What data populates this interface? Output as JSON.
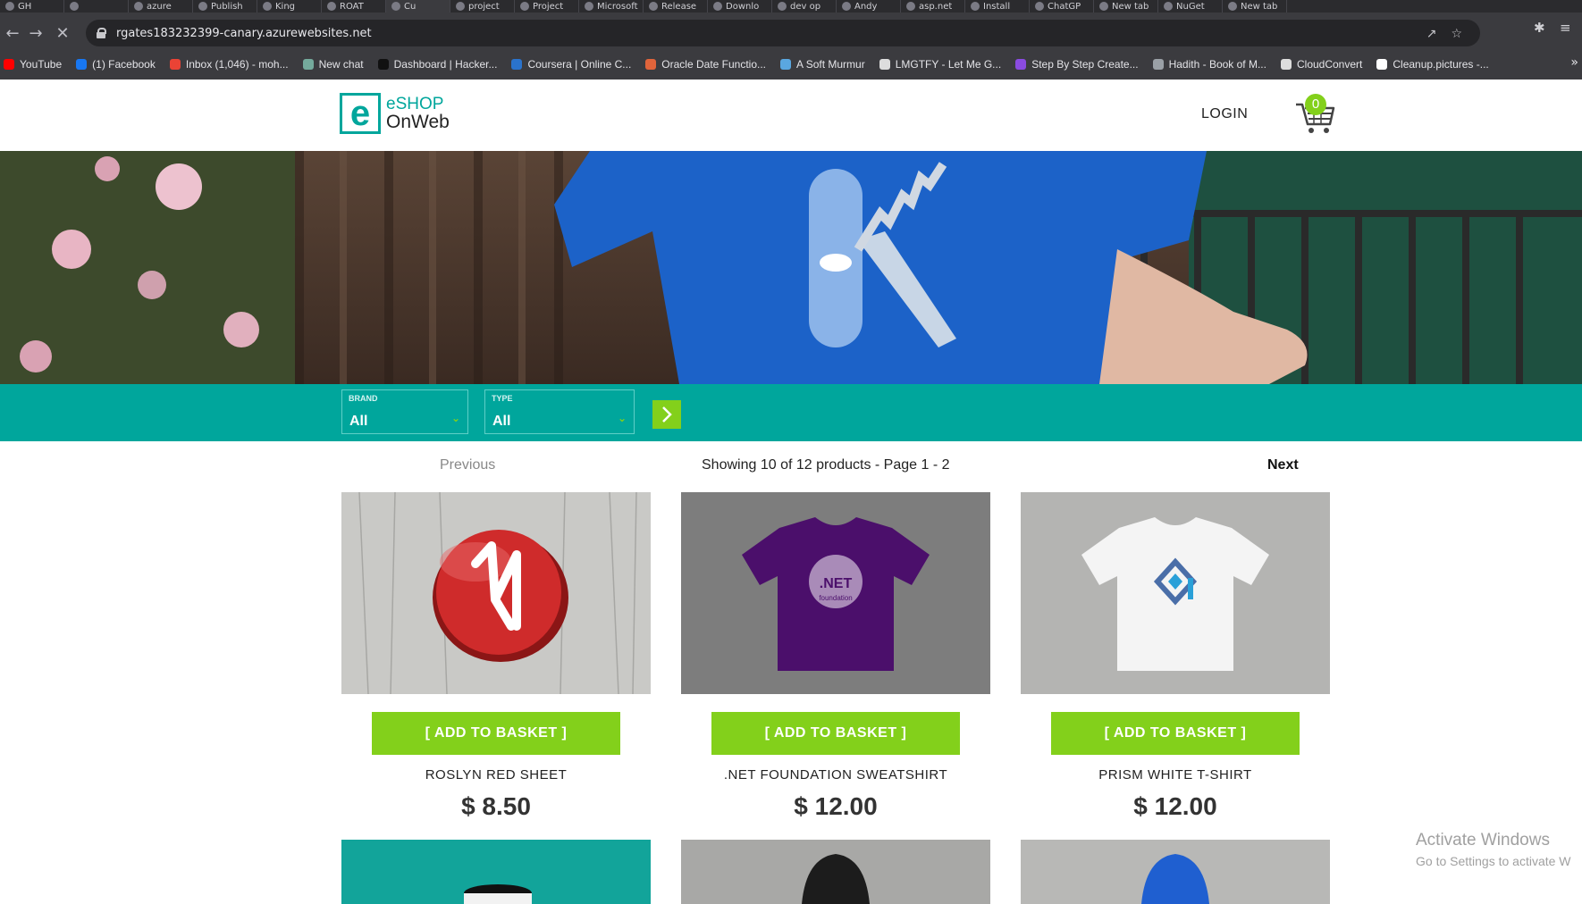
{
  "browser": {
    "tabs": [
      "GH",
      "",
      "azure",
      "Publish",
      "King",
      "ROAT",
      "Cu",
      "project",
      "Project",
      "Microsoft",
      "Release",
      "Downlo",
      "dev op",
      "Andy",
      "asp.net",
      "Install",
      "ChatGP",
      "New tab",
      "NuGet",
      "New tab"
    ],
    "url": "rgates183232399-canary.azurewebsites.net",
    "bookmarks": [
      {
        "label": "YouTube",
        "color": "#ff0000"
      },
      {
        "label": "(1) Facebook",
        "color": "#1877f2"
      },
      {
        "label": "Inbox (1,046) - moh...",
        "color": "#ea4335"
      },
      {
        "label": "New chat",
        "color": "#74aa9c"
      },
      {
        "label": "Dashboard | Hacker...",
        "color": "#111111"
      },
      {
        "label": "Coursera | Online C...",
        "color": "#2a73cc"
      },
      {
        "label": "Oracle Date Functio...",
        "color": "#e0643b"
      },
      {
        "label": "A Soft Murmur",
        "color": "#5aa7e0"
      },
      {
        "label": "LMGTFY - Let Me G...",
        "color": "#dddddd"
      },
      {
        "label": "Step By Step Create...",
        "color": "#8a4be0"
      },
      {
        "label": "Hadith - Book of M...",
        "color": "#9aa0a6"
      },
      {
        "label": "CloudConvert",
        "color": "#dddddd"
      },
      {
        "label": "Cleanup.pictures -...",
        "color": "#ffffff"
      }
    ],
    "bookmarks_more": "»"
  },
  "header": {
    "logo_top": "eSHOP",
    "logo_bottom": "OnWeb",
    "login": "LOGIN",
    "cart_count": "0"
  },
  "filters": {
    "brand_label": "BRAND",
    "brand_value": "All",
    "type_label": "TYPE",
    "type_value": "All"
  },
  "pager": {
    "previous": "Previous",
    "info": "Showing 10 of 12 products - Page 1 - 2",
    "next": "Next"
  },
  "products": [
    {
      "name": "ROSLYN RED SHEET",
      "price": "$ 8.50",
      "button": "[ ADD TO BASKET ]"
    },
    {
      "name": ".NET FOUNDATION SWEATSHIRT",
      "price": "$ 12.00",
      "button": "[ ADD TO BASKET ]"
    },
    {
      "name": "PRISM WHITE T-SHIRT",
      "price": "$ 12.00",
      "button": "[ ADD TO BASKET ]"
    }
  ],
  "product_images": {
    "tshirt_logo_text": ".NET",
    "tshirt_logo_sub": "foundation"
  },
  "watermark": {
    "line1": "Activate Windows",
    "line2": "Go to Settings to activate W"
  },
  "colors": {
    "brand_teal": "#00a69c",
    "accent_green": "#83d01b"
  }
}
